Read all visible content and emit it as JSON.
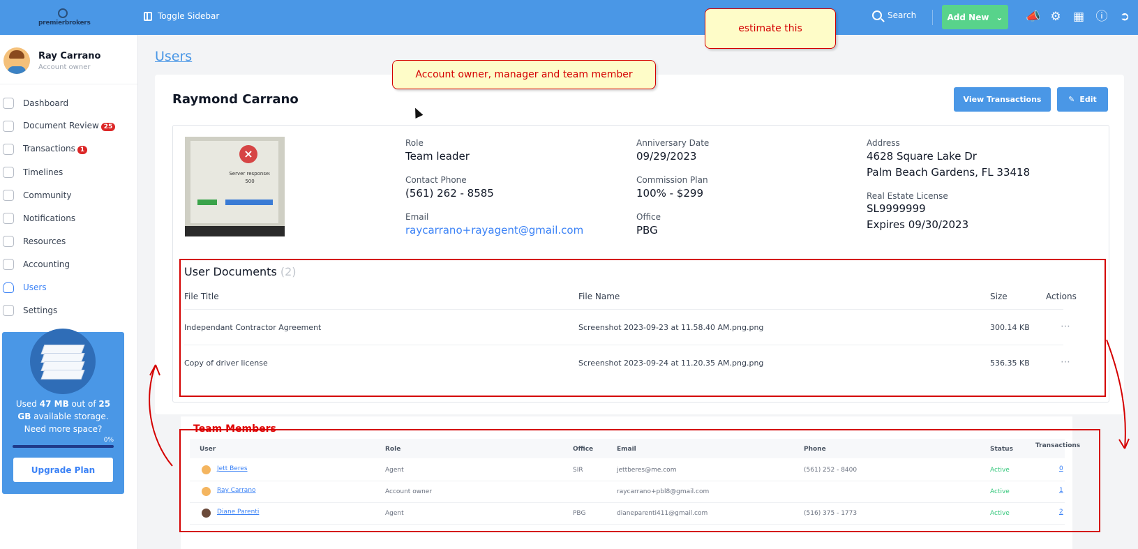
{
  "topbar": {
    "logo_text": "premierbrokers",
    "toggle_label": "Toggle Sidebar",
    "search_label": "Search",
    "add_new_label": "Add New",
    "icons": [
      "bullhorn-icon",
      "gear-icon",
      "calculator-icon",
      "help-icon",
      "logout-icon"
    ]
  },
  "sidebar": {
    "user_name": "Ray Carrano",
    "user_role": "Account owner",
    "items": [
      {
        "label": "Dashboard",
        "icon": "dashboard-icon"
      },
      {
        "label": "Document Review",
        "icon": "document-icon",
        "badge": "25"
      },
      {
        "label": "Transactions",
        "icon": "dollar-icon",
        "badge": "1"
      },
      {
        "label": "Timelines",
        "icon": "timeline-icon"
      },
      {
        "label": "Community",
        "icon": "community-icon"
      },
      {
        "label": "Notifications",
        "icon": "bell-icon"
      },
      {
        "label": "Resources",
        "icon": "folder-icon"
      },
      {
        "label": "Accounting",
        "icon": "ledger-icon"
      },
      {
        "label": "Users",
        "icon": "user-icon",
        "active": true
      },
      {
        "label": "Settings",
        "icon": "gear-icon"
      }
    ],
    "storage": {
      "text_pre": "Used ",
      "used": "47 MB",
      "text_mid": " out of ",
      "total": "25 GB",
      "text_post": " available storage. Need more space?",
      "percent_label": "0%",
      "percent": 0,
      "upgrade_label": "Upgrade Plan"
    }
  },
  "breadcrumb": "Users",
  "profile_card": {
    "name": "Raymond Carrano",
    "view_transactions_label": "View Transactions",
    "edit_label": "Edit",
    "photo": {
      "title": "Server response:",
      "code": "500"
    },
    "fields": {
      "role_label": "Role",
      "role": "Team leader",
      "phone_label": "Contact Phone",
      "phone": "(561) 262 - 8585",
      "email_label": "Email",
      "email": "raycarrano+rayagent@gmail.com",
      "anniversary_label": "Anniversary Date",
      "anniversary": "09/29/2023",
      "commission_label": "Commission Plan",
      "commission": "100% - $299",
      "office_label": "Office",
      "office": "PBG",
      "address_label": "Address",
      "address_line1": "4628 Square Lake Dr",
      "address_line2": "Palm Beach Gardens, FL 33418",
      "license_label": "Real Estate License",
      "license": "SL9999999",
      "license_expiry": "Expires 09/30/2023"
    }
  },
  "documents": {
    "title": "User Documents",
    "count": "(2)",
    "columns": {
      "title": "File Title",
      "name": "File Name",
      "size": "Size",
      "actions": "Actions"
    },
    "rows": [
      {
        "title": "Independant Contractor Agreement",
        "name": "Screenshot 2023-09-23 at 11.58.40 AM.png.png",
        "size": "300.14 KB"
      },
      {
        "title": "Copy of driver license",
        "name": "Screenshot 2023-09-24 at 11.20.35 AM.png.png",
        "size": "536.35 KB"
      }
    ]
  },
  "team": {
    "title": "Team Members",
    "columns": {
      "user": "User",
      "role": "Role",
      "office": "Office",
      "email": "Email",
      "phone": "Phone",
      "status": "Status",
      "transactions": "Transactions"
    },
    "rows": [
      {
        "user": "Jett Beres",
        "role": "Agent",
        "office": "SIR",
        "email": "jettberes@me.com",
        "phone": "(561) 252 - 8400",
        "status": "Active",
        "transactions": "0"
      },
      {
        "user": "Ray Carrano",
        "role": "Account owner",
        "office": "",
        "email": "raycarrano+pbl8@gmail.com",
        "phone": "",
        "status": "Active",
        "transactions": "1"
      },
      {
        "user": "Diane Parenti",
        "role": "Agent",
        "office": "PBG",
        "email": "dianeparenti411@gmail.com",
        "phone": "(516) 375 - 1773",
        "status": "Active",
        "transactions": "2"
      }
    ]
  },
  "annotations": {
    "note_owner": "Account owner, manager and team member",
    "note_estimate": "estimate this",
    "color": "#d40000"
  }
}
